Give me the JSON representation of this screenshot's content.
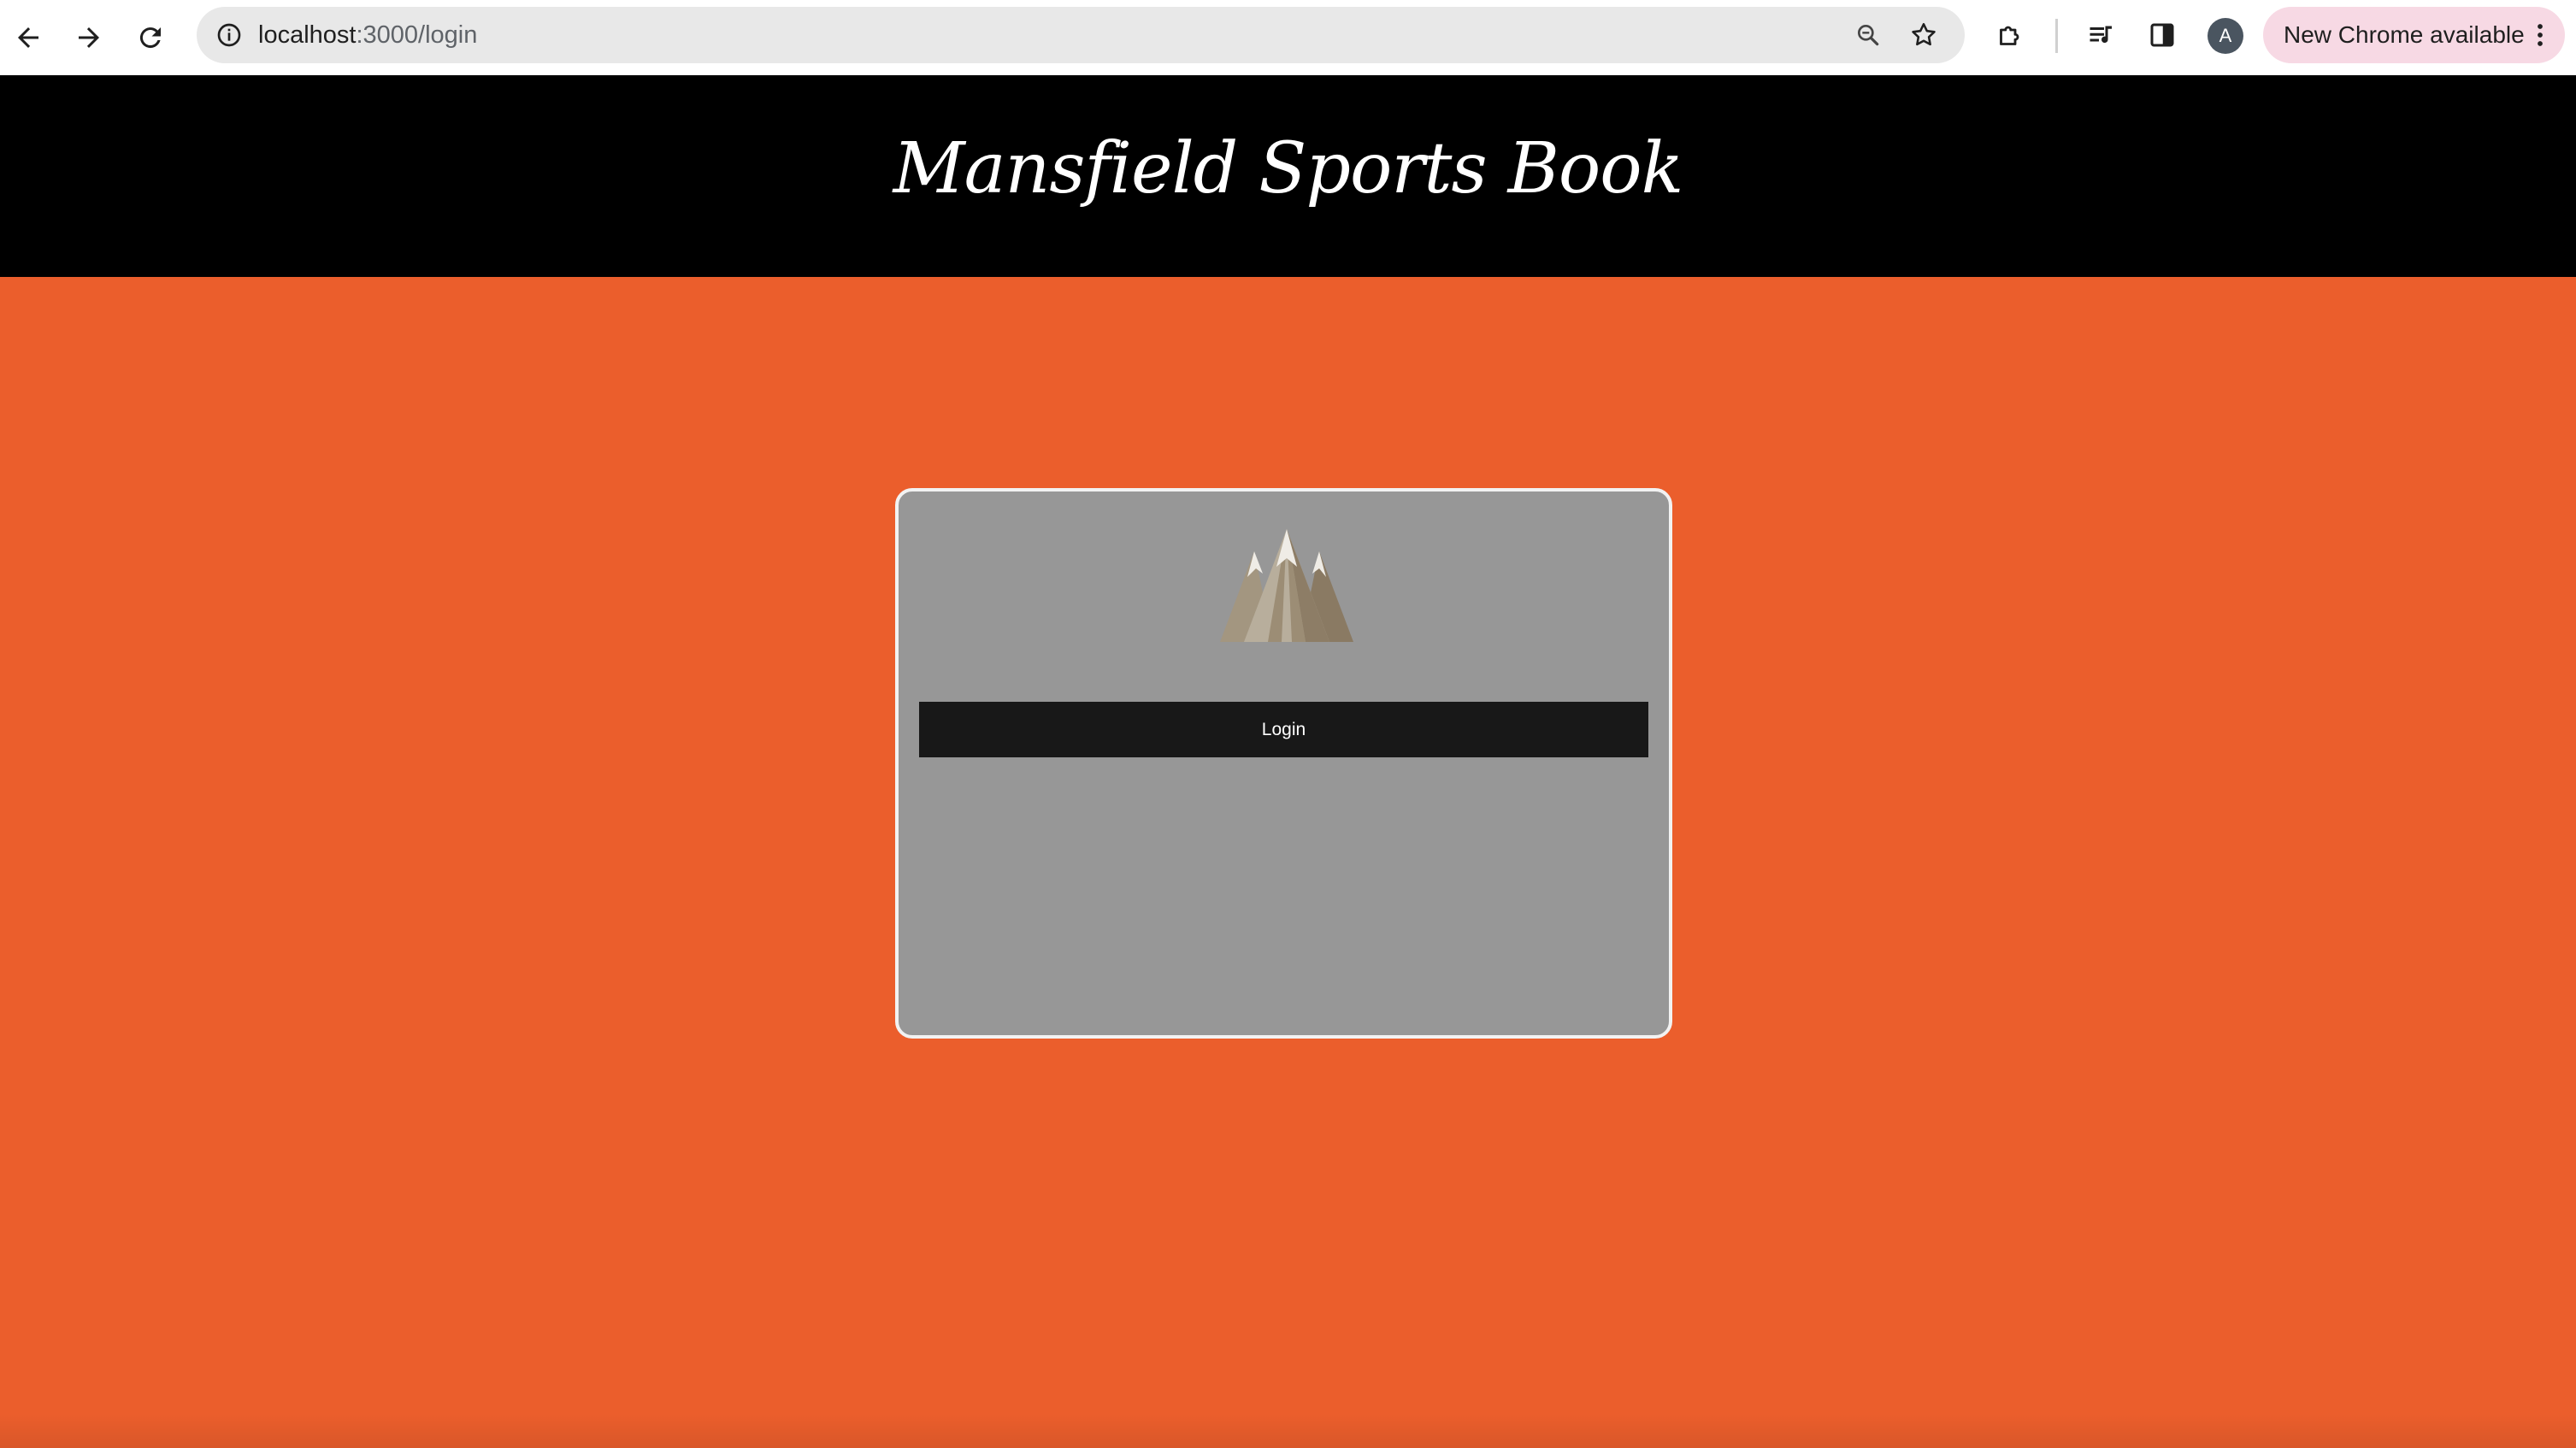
{
  "browser": {
    "url_host": "localhost",
    "url_path": ":3000/login",
    "profile_initial": "A",
    "update_label": "New Chrome available",
    "icons": {
      "back": "back-arrow-icon",
      "forward": "forward-arrow-icon",
      "reload": "reload-icon",
      "site_info": "info-icon",
      "zoom": "zoom-icon",
      "bookmark": "star-icon",
      "extensions": "puzzle-icon",
      "media": "media-queue-icon",
      "side_panel": "side-panel-icon",
      "menu": "kebab-menu-icon"
    }
  },
  "site": {
    "title": "Mansfield Sports Book"
  },
  "login": {
    "logo": "mountain-logo",
    "button_label": "Login"
  },
  "colors": {
    "header_bg": "#000000",
    "page_bg": "#eb5e2c",
    "card_bg": "#979797",
    "card_border": "#f2f2f2",
    "button_bg": "#181818",
    "update_pill_bg": "#f7d9e4"
  }
}
